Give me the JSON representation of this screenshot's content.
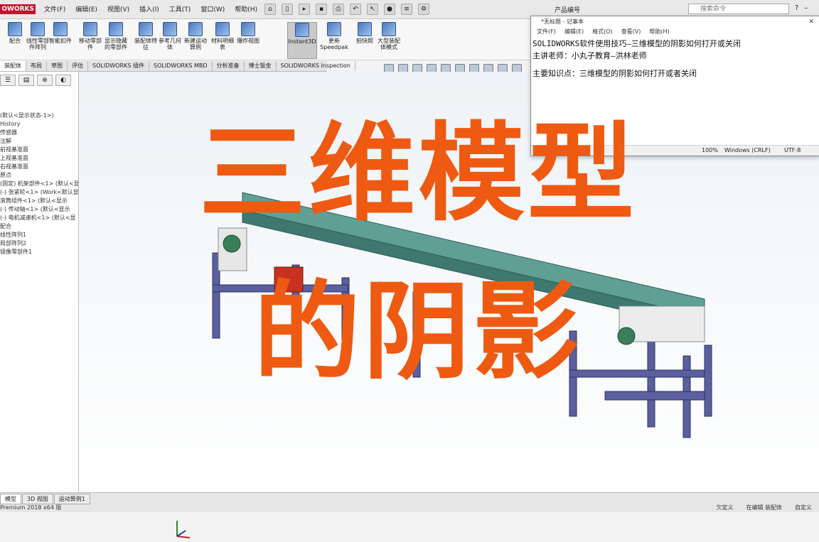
{
  "app": {
    "logo_text": "OWORKS",
    "brand_color": "#c8102e",
    "menu": [
      "文件(F)",
      "编辑(E)",
      "视图(V)",
      "插入(I)",
      "工具(T)",
      "窗口(W)",
      "帮助(H)"
    ],
    "window_title": "产品编号",
    "search_placeholder": "搜索命令"
  },
  "ribbon": {
    "buttons": [
      "配合",
      "线性零部件阵列",
      "智能扣件",
      "移动零部件",
      "显示隐藏的零部件",
      "装配体特征",
      "参考几何体",
      "新建运动算例",
      "材料明细表",
      "爆炸视图",
      "Instant3D",
      "更新 Speedpak",
      "拍快照",
      "大型装配体模式"
    ],
    "active_button": "Instant3D"
  },
  "tabs": [
    "装配体",
    "布局",
    "草图",
    "评估",
    "SOLIDWORKS 插件",
    "SOLIDWORKS MBD",
    "分析准备",
    "博士钣金",
    "SOLIDWORKS Inspection"
  ],
  "selected_tab": "装配体",
  "feature_tree": [
    "(默认<显示状态-1>)",
    "History",
    "传感器",
    "注解",
    "前视基准面",
    "上视基准面",
    "右视基准面",
    "原点",
    "(固定) 机架部件<1> (默认<显",
    "(-) 张紧轮<1> (Work<默认显",
    "滚筒组件<1> (默认<显示",
    "(-) 传动轴<1> (默认<显示",
    "(-) 电机减速机<1> (默认<显",
    "配合",
    "线性阵列1",
    "局部阵列2",
    "镜像零部件1"
  ],
  "notepad": {
    "title": "*无标题 - 记事本",
    "menu": [
      "文件(F)",
      "编辑(E)",
      "格式(O)",
      "查看(V)",
      "帮助(H)"
    ],
    "line1": "SOLIDWORKS软件使用技巧—三维模型的阴影如何打开或关闭",
    "line2": "主讲老师：小丸子教育—洪林老师",
    "line3": "主要知识点：三维模型的阴影如何打开或者关闭",
    "status_zoom": "100%",
    "status_eol": "Windows (CRLF)",
    "status_enc": "UTF-8"
  },
  "overlay": {
    "line1": "三维模型",
    "line2": "的阴影",
    "color": "#ee5a12"
  },
  "bottom": {
    "tabs": [
      "模型",
      "3D 视图",
      "运动算例1"
    ],
    "status_left": "Premium 2018 x64 版",
    "status_right": [
      "欠定义",
      "在编辑 装配体",
      "自定义"
    ]
  }
}
